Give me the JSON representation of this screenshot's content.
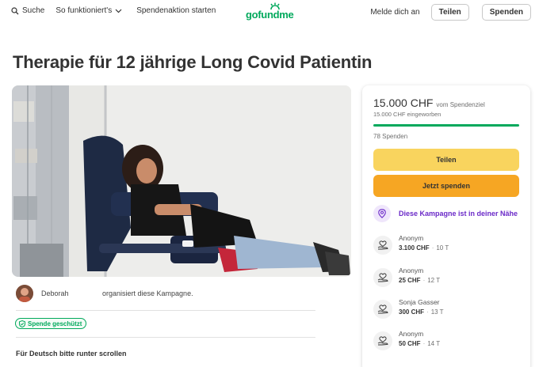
{
  "header": {
    "search_label": "Suche",
    "how_label": "So funktioniert's",
    "start_label": "Spendenaktion starten",
    "logo_text": "gofundme",
    "login_label": "Melde dich an",
    "share_label": "Teilen",
    "donate_label": "Spenden"
  },
  "campaign": {
    "title": "Therapie für 12 jährige Long Covid Patientin",
    "organizer_name": "Deborah",
    "organizer_text": "organisiert diese Kampagne.",
    "badge_label": "Spende geschützt",
    "description_heading": "Für Deutsch bitte runter scrollen"
  },
  "sidebar": {
    "raised_amount": "15.000 CHF",
    "goal_label": "vom Spendenziel",
    "raised_sub": "15.000 CHF eingeworben",
    "progress_percent": 100,
    "donation_count": "78 Spenden",
    "share_button": "Teilen",
    "donate_button": "Jetzt spenden",
    "nearby_label": "Diese Kampagne ist in deiner Nähe",
    "donations": [
      {
        "name": "Anonym",
        "amount": "3.100 CHF",
        "time": "10 T"
      },
      {
        "name": "Anonym",
        "amount": "25 CHF",
        "time": "12 T"
      },
      {
        "name": "Sonja Gasser",
        "amount": "300 CHF",
        "time": "13 T"
      },
      {
        "name": "Anonym",
        "amount": "50 CHF",
        "time": "14 T"
      }
    ]
  },
  "colors": {
    "brand_green": "#02a95c",
    "share_yellow": "#f9d45e",
    "donate_orange": "#f6a623",
    "nearby_purple": "#6b2ac8"
  }
}
